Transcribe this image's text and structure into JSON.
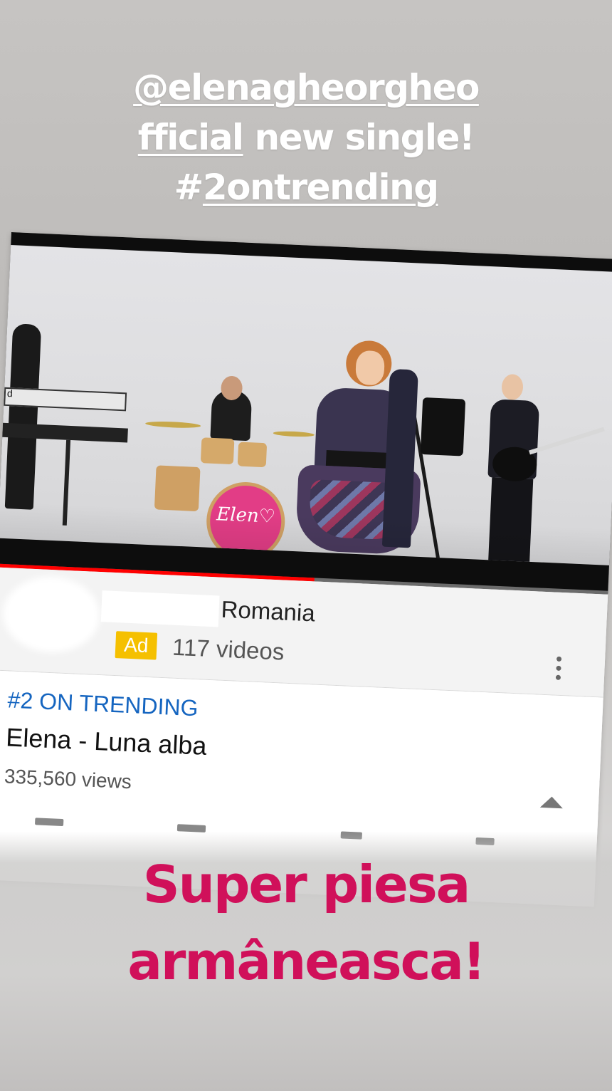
{
  "story": {
    "caption_line1": "@elenagheorgheo",
    "caption_line2_mention": "fficial",
    "caption_line2_rest": " new single!",
    "caption_line3_hash": "#",
    "caption_line3_tag": "2ontrending",
    "promo_line1": "Super piesa",
    "promo_line2": "armâneasca!"
  },
  "video": {
    "drum_text": "Elen♡",
    "keyboard_text": "d",
    "progress_fraction": 0.52
  },
  "channel": {
    "name": "Romania",
    "ad_label": "Ad",
    "video_count": "117 videos"
  },
  "details": {
    "trending_label": "#2 ON TRENDING",
    "title": "Elena - Luna alba",
    "views": "335,560 views"
  },
  "colors": {
    "progress": "#ff0000",
    "ad_badge": "#f5c000",
    "trending": "#1565c0",
    "promo": "#d0105a"
  }
}
